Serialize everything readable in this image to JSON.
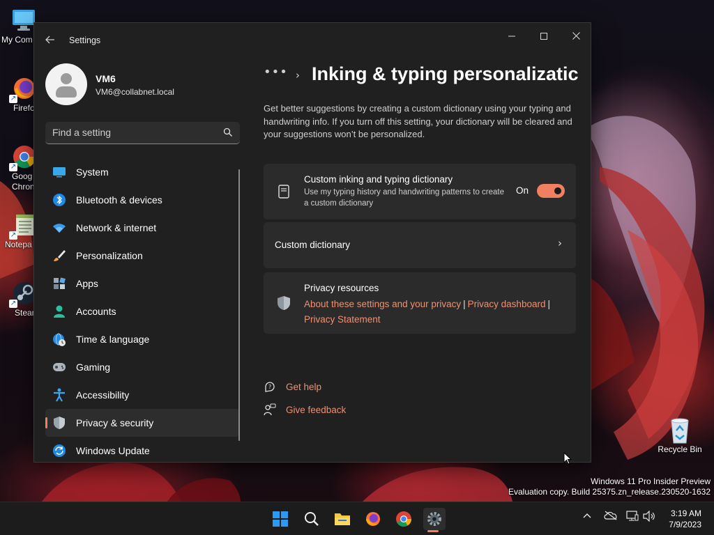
{
  "desktop": {
    "icons": [
      {
        "label": "My Com",
        "icon": "computer-icon"
      },
      {
        "label": "Firefo",
        "icon": "firefox-icon"
      },
      {
        "label": "Goog\nChron",
        "label_line1": "Goog",
        "label_line2": "Chron",
        "icon": "chrome-icon"
      },
      {
        "label": "Notepa",
        "icon": "notepad-icon"
      },
      {
        "label": "Stean",
        "icon": "steam-icon"
      },
      {
        "label": "Recycle Bin",
        "icon": "recycle-bin-icon"
      }
    ]
  },
  "window": {
    "app_title": "Settings",
    "controls": {
      "minimize": "—",
      "maximize": "☐",
      "close": "✕"
    }
  },
  "user": {
    "name": "VM6",
    "email": "VM6@collabnet.local"
  },
  "search": {
    "placeholder": "Find a setting"
  },
  "nav": [
    {
      "label": "System",
      "icon": "system-icon"
    },
    {
      "label": "Bluetooth & devices",
      "icon": "bluetooth-icon"
    },
    {
      "label": "Network & internet",
      "icon": "network-icon"
    },
    {
      "label": "Personalization",
      "icon": "brush-icon"
    },
    {
      "label": "Apps",
      "icon": "apps-icon"
    },
    {
      "label": "Accounts",
      "icon": "accounts-icon"
    },
    {
      "label": "Time & language",
      "icon": "globe-clock-icon"
    },
    {
      "label": "Gaming",
      "icon": "gamepad-icon"
    },
    {
      "label": "Accessibility",
      "icon": "accessibility-icon"
    },
    {
      "label": "Privacy & security",
      "icon": "shield-icon",
      "active": true
    },
    {
      "label": "Windows Update",
      "icon": "update-icon"
    }
  ],
  "content": {
    "breadcrumb_overflow": "•••",
    "breadcrumb_separator": "›",
    "page_title": "Inking & typing personalizatic",
    "description": "Get better suggestions by creating a custom dictionary using your typing and handwriting info. If you turn off this setting, your dictionary will be cleared and your suggestions won’t be personalized.",
    "dictionary_card": {
      "title": "Custom inking and typing dictionary",
      "subtitle": "Use my typing history and handwriting patterns to create a custom dictionary",
      "toggle_label": "On",
      "toggle_on": true
    },
    "custom_dictionary": {
      "label": "Custom dictionary",
      "chevron": "›"
    },
    "privacy": {
      "title": "Privacy resources",
      "links": [
        "About these settings and your privacy",
        "Privacy dashboard",
        "Privacy Statement"
      ],
      "separator": "|"
    },
    "help": [
      {
        "label": "Get help",
        "icon": "get-help-icon"
      },
      {
        "label": "Give feedback",
        "icon": "feedback-icon"
      }
    ]
  },
  "watermark": {
    "line1": "Windows 11 Pro Insider Preview",
    "line2": "Evaluation copy. Build 25375.zn_release.230520-1632"
  },
  "taskbar": {
    "apps": [
      "start-icon",
      "search-icon",
      "file-explorer-icon",
      "firefox-icon",
      "chrome-icon",
      "settings-icon"
    ],
    "tray": {
      "chevron": "^",
      "time": "3:19 AM",
      "date": "7/9/2023"
    }
  },
  "colors": {
    "accent": "#f08060",
    "window_bg": "#202020",
    "card_bg": "#2b2b2b",
    "link": "#f09070"
  }
}
